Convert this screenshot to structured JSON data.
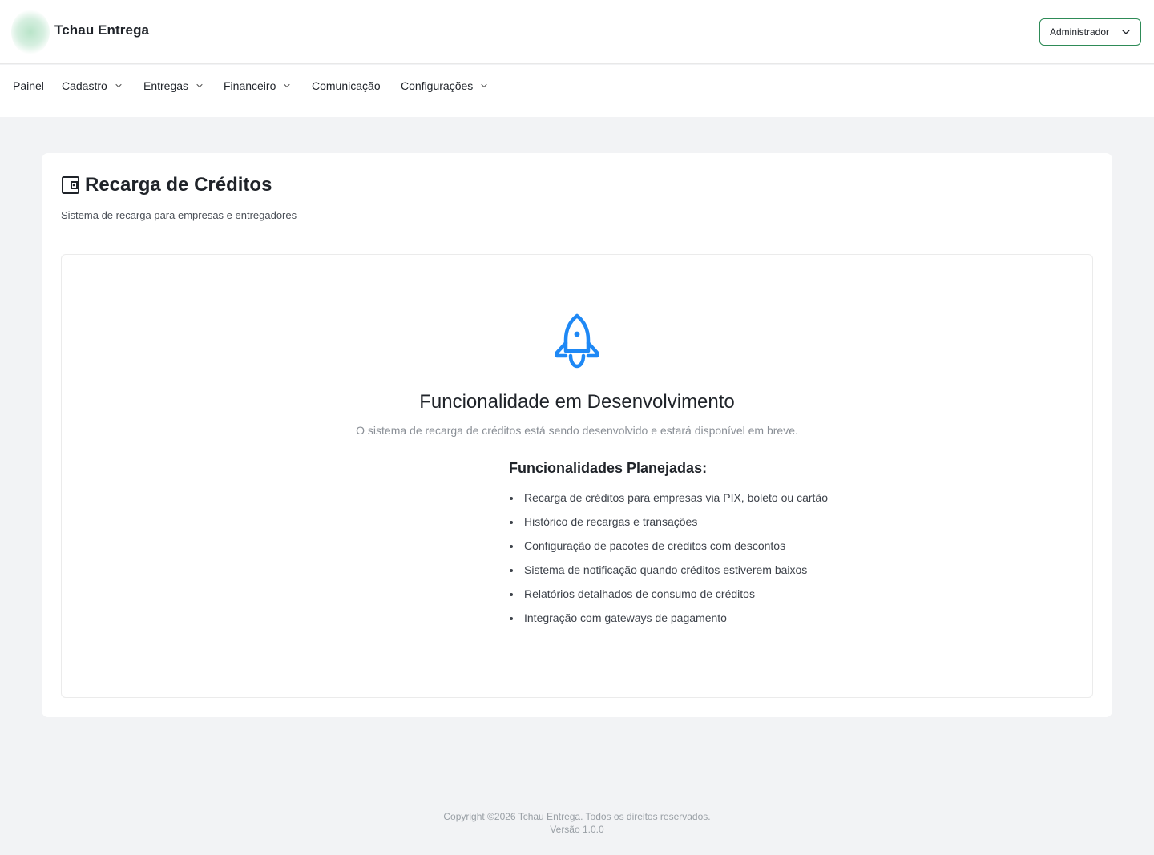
{
  "header": {
    "app_title": "Tchau Entrega",
    "user_menu_label": "Administrador"
  },
  "nav": {
    "items": [
      {
        "label": "Painel",
        "has_dropdown": false
      },
      {
        "label": "Cadastro",
        "has_dropdown": true
      },
      {
        "label": "Entregas",
        "has_dropdown": true
      },
      {
        "label": "Financeiro",
        "has_dropdown": true
      },
      {
        "label": "Comunicação",
        "has_dropdown": false
      },
      {
        "label": "Configurações",
        "has_dropdown": true
      }
    ]
  },
  "page": {
    "title": "Recarga de Créditos",
    "subtitle": "Sistema de recarga para empresas e entregadores",
    "title_icon": "wallet-icon"
  },
  "notice": {
    "icon": "rocket-icon",
    "title": "Funcionalidade em Desenvolvimento",
    "description": "O sistema de recarga de créditos está sendo desenvolvido e estará disponível em breve.",
    "planned_heading": "Funcionalidades Planejadas:",
    "planned_items": [
      "Recarga de créditos para empresas via PIX, boleto ou cartão",
      "Histórico de recargas e transações",
      "Configuração de pacotes de créditos com descontos",
      "Sistema de notificação quando créditos estiverem baixos",
      "Relatórios detalhados de consumo de créditos",
      "Integração com gateways de pagamento"
    ]
  },
  "footer": {
    "copyright": "Copyright ©2026 Tchau Entrega. Todos os direitos reservados.",
    "version": "Versão 1.0.0"
  },
  "colors": {
    "accent": "#1e88f5",
    "user_menu_border": "#2e8b57",
    "background": "#f2f3f5"
  }
}
